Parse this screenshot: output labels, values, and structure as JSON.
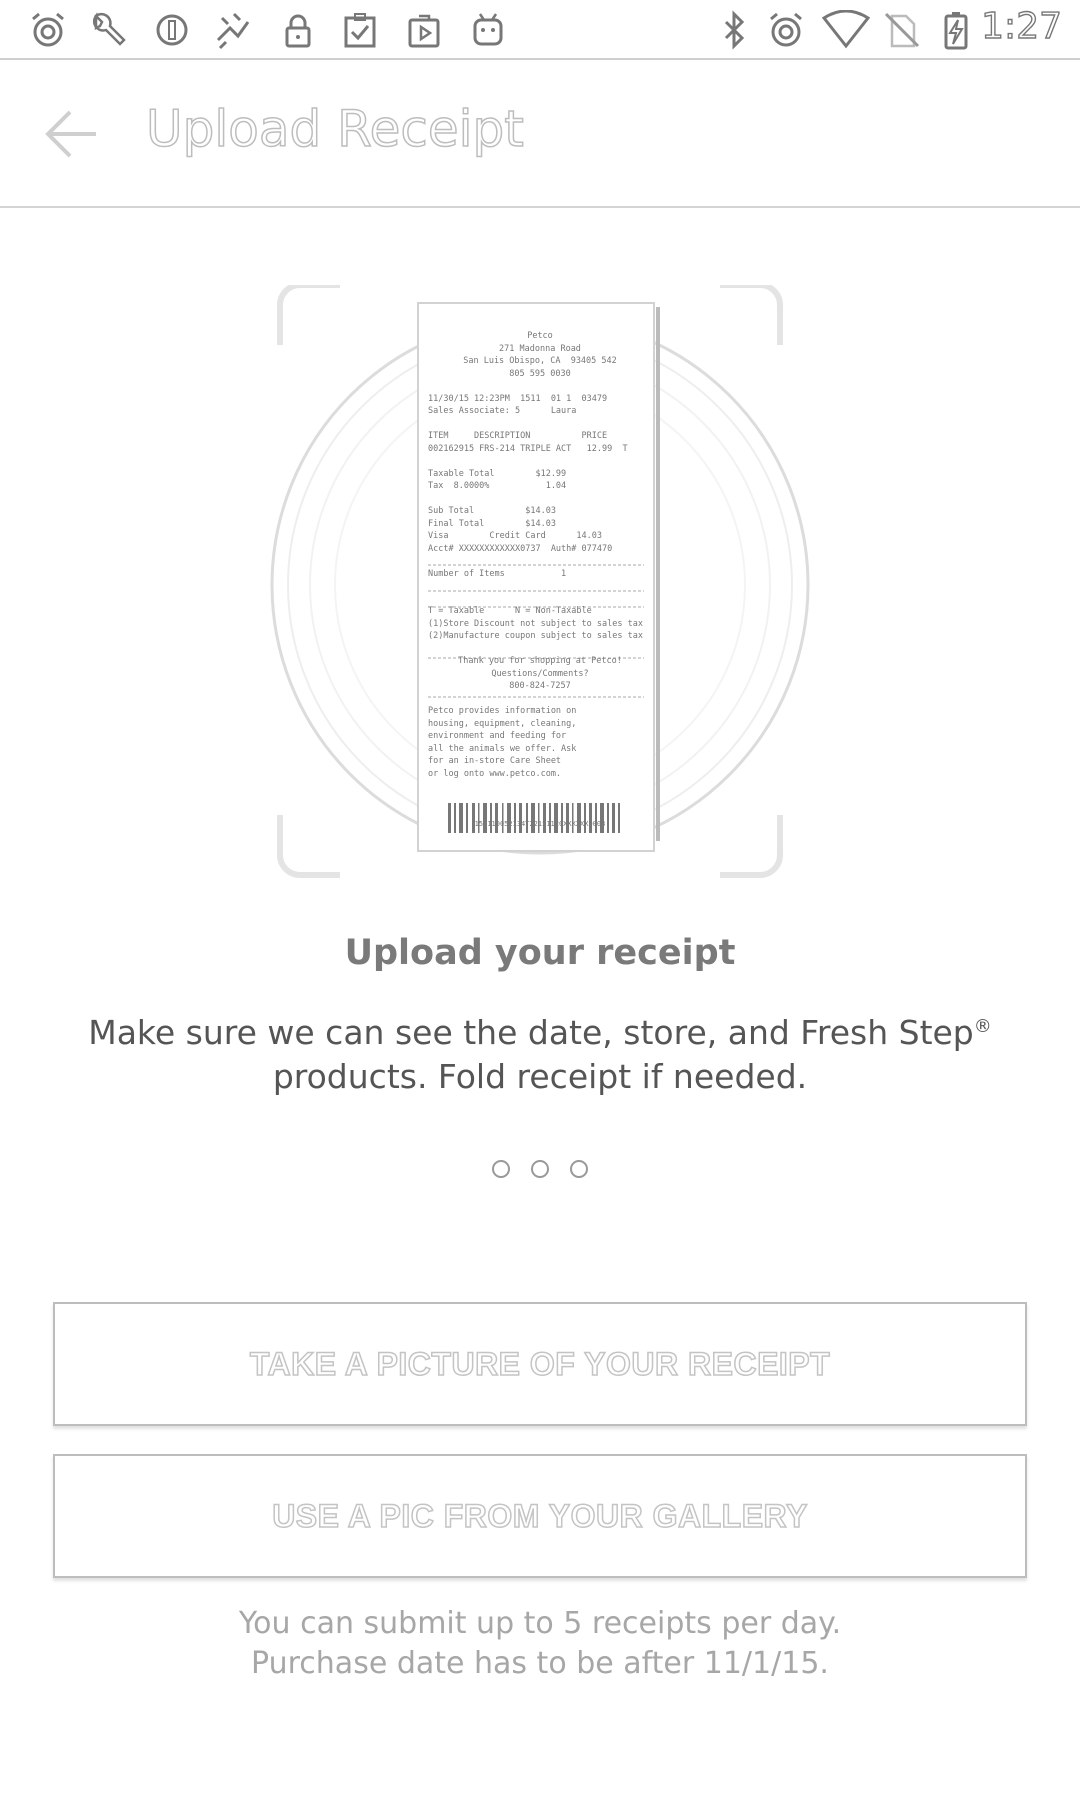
{
  "status_bar": {
    "time": "1:27",
    "left_icons": [
      "alarm-icon",
      "wrench-icon",
      "circle-icon",
      "plugin-icon",
      "lock-icon",
      "clipboard-icon",
      "play-store-icon",
      "android-icon"
    ],
    "right_icons": [
      "bluetooth-icon",
      "alarm-icon",
      "wifi-icon",
      "no-sim-icon",
      "battery-charging-icon"
    ]
  },
  "app_bar": {
    "back_icon": "arrow-left-icon",
    "title": "Upload Receipt"
  },
  "receipt": {
    "store": "Petco",
    "address_1": "271 Madonna Road",
    "address_2": "San Luis Obispo, CA  93405 542",
    "phone": "805 595 0030",
    "date_line": "11/30/15 12:23PM  1511  01 1  03479",
    "associate": "Sales Associate: 5      Laura",
    "header": "ITEM     DESCRIPTION          PRICE",
    "item": "002162915 FRS-214 TRIPLE ACT   12.99  T",
    "taxable_total": "Taxable Total        $12.99",
    "tax": "Tax  8.0000%           1.04",
    "sub_total": "Sub Total          $14.03",
    "final_total": "Final Total        $14.03",
    "credit": "Visa        Credit Card      14.03",
    "acct": "Acct# XXXXXXXXXXXX0737  Auth# 077470",
    "items_count": "Number of Items           1",
    "legend_1": "T = Taxable      N = Non-Taxable",
    "legend_2": "(1)Store Discount not subject to sales tax",
    "legend_3": "(2)Manufacture coupon subject to sales tax",
    "thanks_1": "Thank you for shopping at Petco!",
    "thanks_2": "Questions/Comments?",
    "thanks_3": "800-824-7257",
    "info_1": "Petco provides information on",
    "info_2": "housing, equipment, cleaning,",
    "info_3": "environment and feeding for",
    "info_4": "all the animals we offer. Ask",
    "info_5": "for an in-store Care Sheet",
    "info_6": "or log onto www.petco.com.",
    "barcode_number": "151110052134T22151120XXXXXX0003"
  },
  "content": {
    "heading": "Upload your receipt",
    "description_line1": "Make sure we can see the date, store, and Fresh Step",
    "registered_mark": "®",
    "description_line2": "products. Fold receipt if needed.",
    "pager_dots": 3
  },
  "buttons": {
    "take_picture": "TAKE A PICTURE OF YOUR RECEIPT",
    "use_gallery": "USE A PIC FROM YOUR GALLERY"
  },
  "note": {
    "line1": "You can submit up to 5 receipts per day.",
    "line2": "Purchase date has to be after 11/1/15."
  }
}
